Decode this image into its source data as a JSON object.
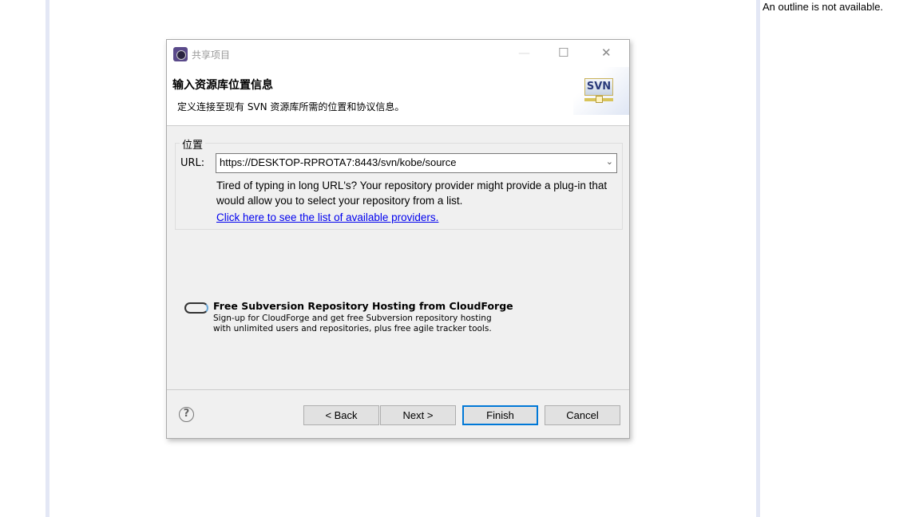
{
  "background": {
    "outline_text": "An outline is not available."
  },
  "dialog": {
    "title": "共享项目",
    "window_buttons": {
      "minimize": "—",
      "maximize": "☐",
      "close": "✕"
    },
    "header": {
      "title": "输入资源库位置信息",
      "description": "定义连接至现有 SVN 资源库所需的位置和协议信息。",
      "logo_text": "SVN"
    },
    "location_group": {
      "label": "位置",
      "url_label": "URL:",
      "url_value": "https://DESKTOP-RPROTA7:8443/svn/kobe/source",
      "tip": "Tired of typing in long URL's?  Your repository provider might provide a plug-in that would allow you to select your repository from a list.",
      "link": "Click here to see the list of available providers."
    },
    "cloudforge": {
      "title": "Free Subversion Repository Hosting from CloudForge",
      "line1": "Sign-up for CloudForge and get free Subversion repository hosting",
      "line2": "with unlimited users and repositories, plus free agile tracker tools."
    },
    "buttons": {
      "help": "?",
      "back": "< Back",
      "next": "Next >",
      "finish": "Finish",
      "cancel": "Cancel"
    },
    "accent_color": "#0078d7"
  }
}
